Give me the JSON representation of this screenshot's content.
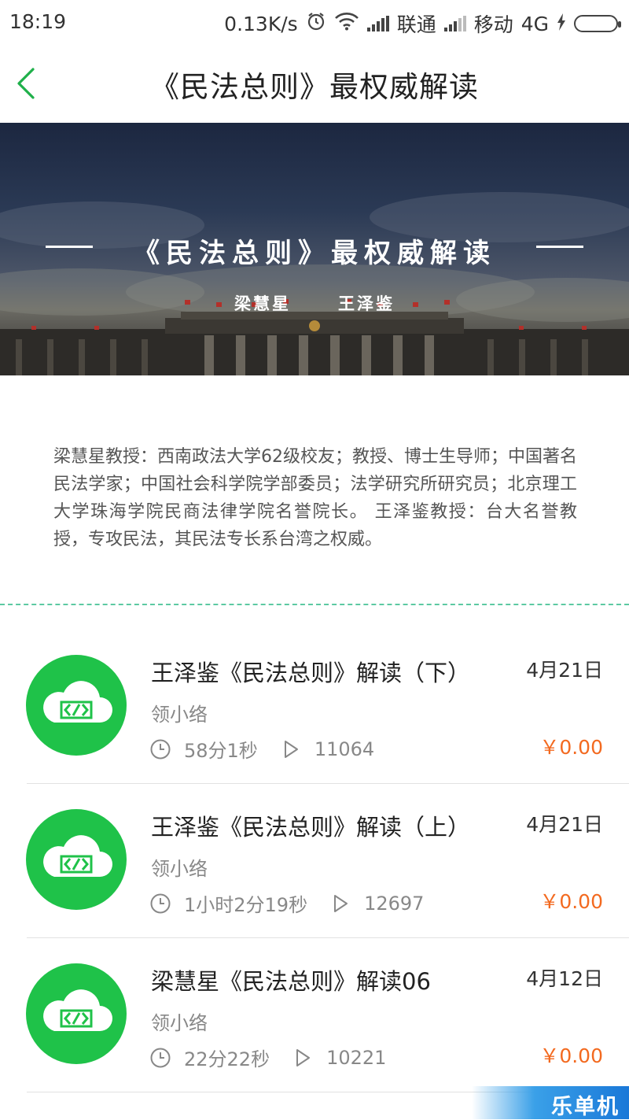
{
  "status_bar": {
    "time": "18:19",
    "speed": "0.13K/s",
    "carrier1": "联通",
    "carrier2": "移动",
    "network": "4G"
  },
  "nav": {
    "title": "《民法总则》最权威解读",
    "back_icon": "chevron-left-icon"
  },
  "banner": {
    "title": "《民法总则》最权威解读",
    "author1": "梁慧星",
    "author2": "王泽鉴"
  },
  "intro": {
    "text": "梁慧星教授：西南政法大学62级校友；教授、博士生导师；中国著名民法学家；中国社会科学院学部委员；法学研究所研究员；北京理工大学珠海学院民商法律学院名誉院长。 王泽鉴教授：台大名誉教授，专攻民法，其民法专长系台湾之权威。"
  },
  "list": {
    "items": [
      {
        "title": "王泽鉴《民法总则》解读（下）",
        "date": "4月21日",
        "author": "领小络",
        "duration": "58分1秒",
        "plays": "11064",
        "price": "￥0.00"
      },
      {
        "title": "王泽鉴《民法总则》解读（上）",
        "date": "4月21日",
        "author": "领小络",
        "duration": "1小时2分19秒",
        "plays": "12697",
        "price": "￥0.00"
      },
      {
        "title": "梁慧星《民法总则》解读06",
        "date": "4月12日",
        "author": "领小络",
        "duration": "22分22秒",
        "plays": "10221",
        "price": "￥0.00"
      }
    ]
  },
  "watermark": {
    "text": "乐单机"
  },
  "colors": {
    "accent_green": "#1fc249",
    "price_orange": "#f36a20",
    "dashed_line": "#5cc9a2"
  }
}
